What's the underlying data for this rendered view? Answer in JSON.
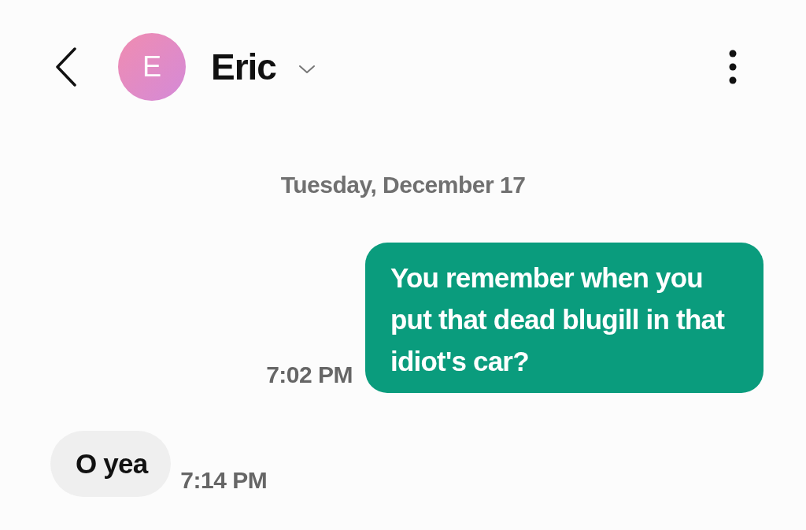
{
  "header": {
    "avatar_letter": "E",
    "title": "Eric"
  },
  "date_divider": "Tuesday, December 17",
  "messages": [
    {
      "kind": "sent",
      "lines": [
        "You remember when you",
        "put that dead blugill in that",
        "idiot's car?"
      ],
      "time": "7:02 PM"
    },
    {
      "kind": "received",
      "lines": [
        "O yea"
      ],
      "time": "7:14 PM"
    }
  ]
}
